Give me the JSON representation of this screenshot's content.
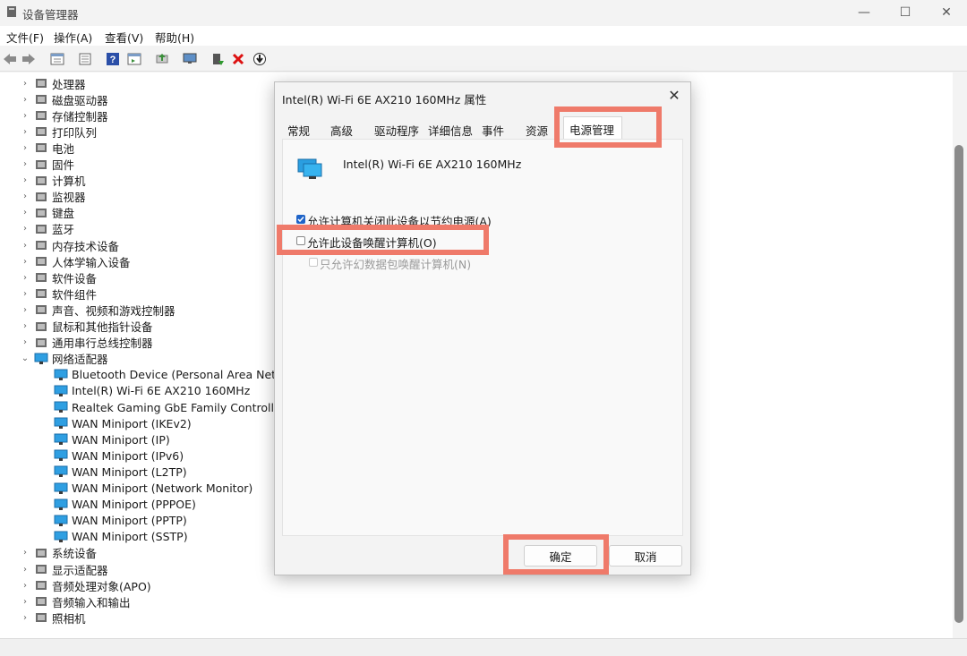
{
  "window": {
    "title": "设备管理器",
    "minimize": "—",
    "maximize": "☐",
    "close": "✕"
  },
  "menu": [
    "文件(F)",
    "操作(A)",
    "查看(V)",
    "帮助(H)"
  ],
  "toolbar_icons": [
    "back-icon",
    "forward-icon",
    "properties-view-icon",
    "list-icon",
    "help-icon",
    "properties-icon",
    "update-icon",
    "monitor-icon",
    "enable-icon",
    "uninstall-icon",
    "download-icon"
  ],
  "tree": {
    "categories_top": [
      "处理器",
      "磁盘驱动器",
      "存储控制器",
      "打印队列",
      "电池",
      "固件",
      "计算机",
      "监视器",
      "键盘",
      "蓝牙",
      "内存技术设备",
      "人体学输入设备",
      "软件设备",
      "软件组件",
      "声音、视频和游戏控制器",
      "鼠标和其他指针设备",
      "通用串行总线控制器"
    ],
    "expanded": "网络适配器",
    "network_adapters": [
      "Bluetooth Device (Personal Area Network",
      "Intel(R) Wi-Fi 6E AX210 160MHz",
      "Realtek Gaming GbE Family Controller",
      "WAN Miniport (IKEv2)",
      "WAN Miniport (IP)",
      "WAN Miniport (IPv6)",
      "WAN Miniport (L2TP)",
      "WAN Miniport (Network Monitor)",
      "WAN Miniport (PPPOE)",
      "WAN Miniport (PPTP)",
      "WAN Miniport (SSTP)"
    ],
    "categories_bottom": [
      "系统设备",
      "显示适配器",
      "音频处理对象(APO)",
      "音频输入和输出",
      "照相机"
    ]
  },
  "dialog": {
    "title": "Intel(R) Wi-Fi 6E AX210 160MHz 属性",
    "close": "✕",
    "tabs": [
      "常规",
      "高级",
      "驱动程序",
      "详细信息",
      "事件",
      "资源"
    ],
    "active_tab": "电源管理",
    "device_name": "Intel(R) Wi-Fi 6E AX210 160MHz",
    "option1": {
      "label": "允许计算机关闭此设备以节约电源(A)",
      "checked": true
    },
    "option2": {
      "label": "允许此设备唤醒计算机(O)",
      "checked": false
    },
    "option3": {
      "label": "只允许幻数据包唤醒计算机(N)",
      "checked": false,
      "disabled": true
    },
    "ok": "确定",
    "cancel": "取消"
  },
  "colors": {
    "highlight": "#ef7a6a",
    "check": "#1f64c8"
  }
}
